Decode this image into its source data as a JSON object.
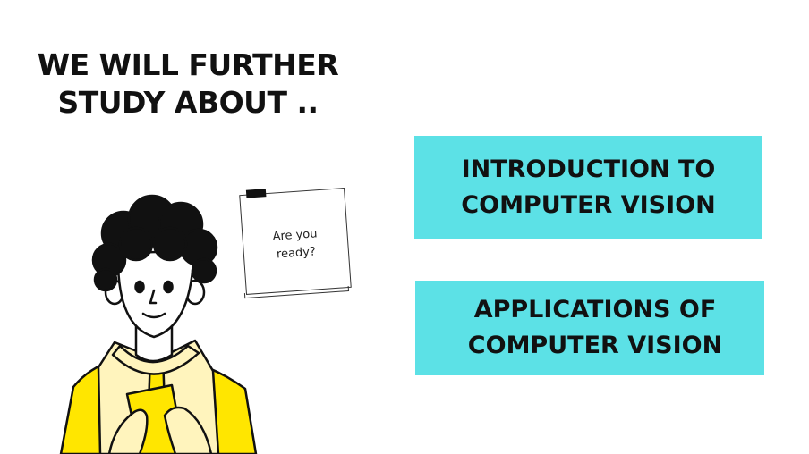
{
  "heading": {
    "line1": "WE WILL FURTHER",
    "line2": "STUDY ABOUT .."
  },
  "topics": [
    {
      "line1": "INTRODUCTION TO",
      "line2": "COMPUTER VISION"
    },
    {
      "line1": "APPLICATIONS OF",
      "line2": "COMPUTER VISION"
    }
  ],
  "sticky_note": {
    "line1": "Are you",
    "line2": "ready?"
  },
  "colors": {
    "card_bg": "#5ce1e6",
    "shirt": "#ffe600",
    "vest": "#fff4bd",
    "text": "#111111"
  }
}
